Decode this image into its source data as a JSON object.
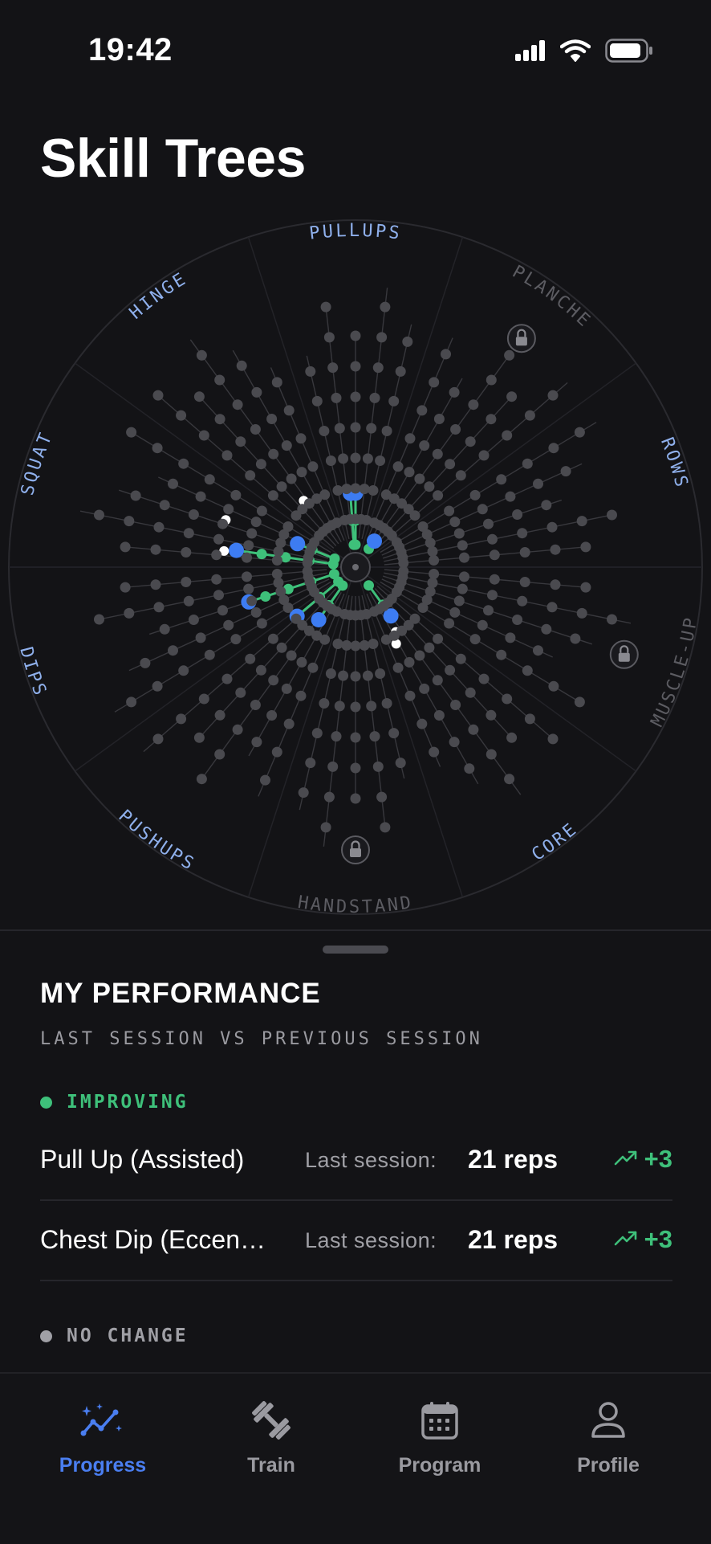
{
  "status_bar": {
    "time": "19:42",
    "icons": [
      "signal-icon",
      "wifi-icon",
      "battery-icon"
    ]
  },
  "page_title": "Skill Trees",
  "skill_tree": {
    "categories": [
      {
        "name": "PULLUPS",
        "status": "active"
      },
      {
        "name": "PLANCHE",
        "status": "locked"
      },
      {
        "name": "ROWS",
        "status": "active"
      },
      {
        "name": "MUSCLE-UP",
        "status": "locked"
      },
      {
        "name": "CORE",
        "status": "active"
      },
      {
        "name": "HANDSTAND",
        "status": "locked"
      },
      {
        "name": "PUSHUPS",
        "status": "active"
      },
      {
        "name": "DIPS",
        "status": "active"
      },
      {
        "name": "SQUAT",
        "status": "active"
      },
      {
        "name": "HINGE",
        "status": "active"
      }
    ],
    "colors": {
      "active_label": "#8fb0ec",
      "locked_label": "#5c5c62",
      "progress_line": "#3ec07a",
      "current_node": "#3d7cf2",
      "node": "#4a4a4f",
      "ring": "#2a2a2f"
    }
  },
  "performance": {
    "title": "MY PERFORMANCE",
    "subtitle": "LAST SESSION VS PREVIOUS SESSION",
    "groups": [
      {
        "label": "IMPROVING",
        "items": [
          {
            "exercise": "Pull Up (Assisted)",
            "last_label": "Last session:",
            "last_value": "21 reps",
            "change": "+3"
          },
          {
            "exercise": "Chest Dip (Eccen…",
            "last_label": "Last session:",
            "last_value": "21 reps",
            "change": "+3"
          }
        ]
      },
      {
        "label": "NO CHANGE",
        "items": []
      }
    ],
    "colors": {
      "improving": "#3ec07a",
      "no_change": "#a0a0a6"
    }
  },
  "tab_bar": {
    "tabs": [
      {
        "label": "Progress",
        "icon": "progress-sparkle-icon",
        "active": true
      },
      {
        "label": "Train",
        "icon": "dumbbell-icon",
        "active": false
      },
      {
        "label": "Program",
        "icon": "calendar-icon",
        "active": false
      },
      {
        "label": "Profile",
        "icon": "person-icon",
        "active": false
      }
    ],
    "colors": {
      "active": "#4a7ef0",
      "inactive": "#9a9aa0"
    }
  }
}
